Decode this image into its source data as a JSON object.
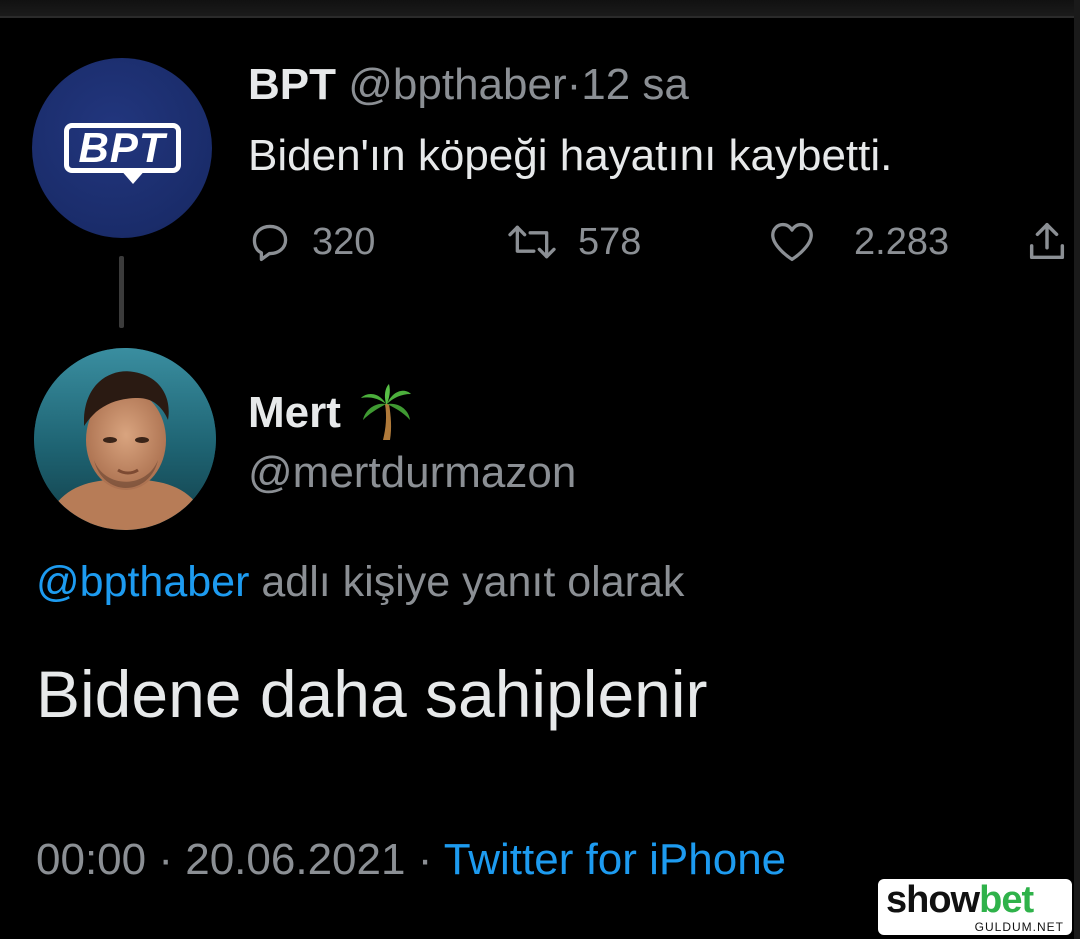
{
  "parent_tweet": {
    "avatar_logo": "BPT",
    "name": "BPT",
    "handle": "@bpthaber",
    "separator": "·",
    "time": "12 sa",
    "text": "Biden'ın köpeği hayatını kaybetti.",
    "actions": {
      "replies": "320",
      "retweets": "578",
      "likes": "2.283"
    },
    "icons": [
      "reply-icon",
      "retweet-icon",
      "like-icon",
      "share-icon"
    ]
  },
  "reply_tweet": {
    "name": "Mert",
    "name_emoji": "palm-tree-icon",
    "handle": "@mertdurmazon",
    "reply_to_handle": "@bpthaber",
    "reply_to_suffix": "adlı kişiye yanıt olarak",
    "text": "Bidene daha sahiplenir",
    "time": "00:00",
    "separator_1": "·",
    "date": "20.06.2021",
    "separator_2": "·",
    "source": "Twitter for iPhone"
  },
  "watermark": {
    "brand_part_1": "show",
    "brand_part_2": "bet",
    "sub": "GULDUM.NET"
  },
  "colors": {
    "background": "#000000",
    "text": "#e7e9ea",
    "muted": "#8b8f94",
    "link": "#1d9bf0",
    "bpt_avatar": "#1a2c6a",
    "watermark_green": "#2fb24a"
  }
}
